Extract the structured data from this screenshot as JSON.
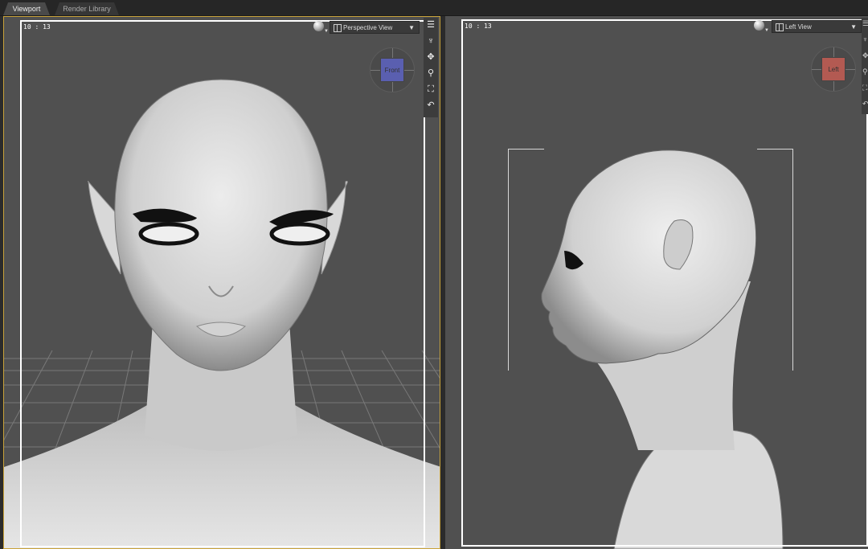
{
  "tabs": [
    {
      "label": "Viewport",
      "active": true
    },
    {
      "label": "Render Library",
      "active": false
    }
  ],
  "left_viewport": {
    "fps": "10 : 13",
    "camera_label": "Perspective View",
    "nav_cube_label": "Front",
    "nav_cube_color": "#5a5fb0"
  },
  "right_viewport": {
    "fps": "10 : 13",
    "camera_label": "Left View",
    "nav_cube_label": "Left",
    "nav_cube_color": "#b35a52"
  },
  "viewport_tools": [
    "viewport-options-icon",
    "orbit-icon",
    "pan-icon",
    "zoom-icon",
    "frame-icon",
    "reset-view-icon"
  ],
  "colors": {
    "viewport_bg": "#505050",
    "active_border": "#c8a23a",
    "frame": "#ffffff"
  }
}
